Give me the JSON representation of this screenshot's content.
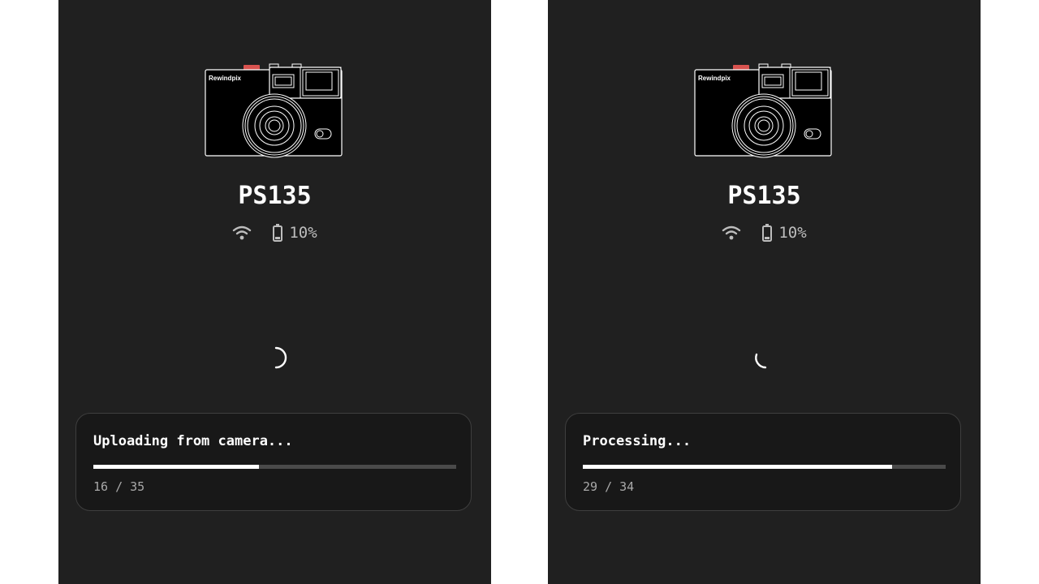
{
  "colors": {
    "background": "#202020",
    "card": "#181818",
    "accent": "#d9534f",
    "progress_fill": "#ffffff",
    "progress_track": "#4a4a4a"
  },
  "screens": [
    {
      "camera_brand": "Rewindpix",
      "device_name": "PS135",
      "battery": "10%",
      "status_text": "Uploading from camera...",
      "progress": {
        "current": 16,
        "total": 35,
        "label": "16 / 35",
        "fraction": 0.457
      }
    },
    {
      "camera_brand": "Rewindpix",
      "device_name": "PS135",
      "battery": "10%",
      "status_text": "Processing...",
      "progress": {
        "current": 29,
        "total": 34,
        "label": "29 / 34",
        "fraction": 0.853
      }
    }
  ]
}
